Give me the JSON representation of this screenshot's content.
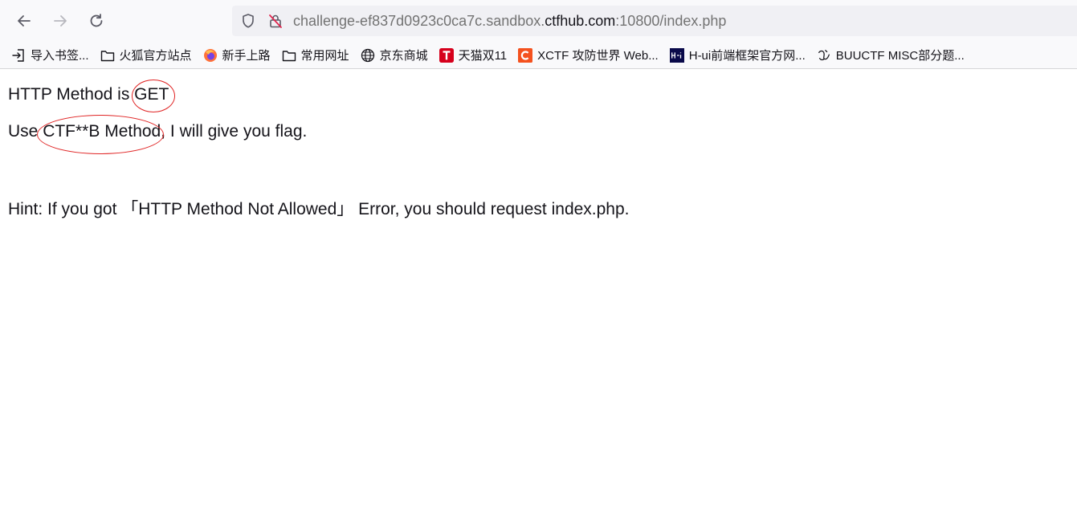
{
  "browser": {
    "url_prefix": "challenge-ef837d0923c0ca7c.sandbox.",
    "url_host": "ctfhub.com",
    "url_suffix": ":10800/index.php",
    "bookmarks": [
      {
        "label": "导入书签...",
        "icon": "import-icon"
      },
      {
        "label": "火狐官方站点",
        "icon": "folder-icon"
      },
      {
        "label": "新手上路",
        "icon": "firefox-icon"
      },
      {
        "label": "常用网址",
        "icon": "folder-icon"
      },
      {
        "label": "京东商城",
        "icon": "globe-icon"
      },
      {
        "label": "天猫双11",
        "icon": "tmall-icon"
      },
      {
        "label": "XCTF 攻防世界 Web...",
        "icon": "xctf-icon"
      },
      {
        "label": "H-ui前端框架官方网...",
        "icon": "hui-icon"
      },
      {
        "label": "BUUCTF MISC部分题...",
        "icon": "buuctf-icon"
      }
    ]
  },
  "page": {
    "line1_prefix": "HTTP Method is ",
    "line1_method": "GET",
    "line2_prefix": "Use ",
    "line2_method": "CTF**B Method",
    "line2_suffix": ", I will give you flag.",
    "hint": "Hint: If you got 「HTTP Method Not Allowed」 Error, you should request index.php."
  },
  "colors": {
    "annotation": "#e02424",
    "tmall": "#d6001c",
    "xctf": "#f4511e",
    "hui": "#0a0a4a"
  }
}
